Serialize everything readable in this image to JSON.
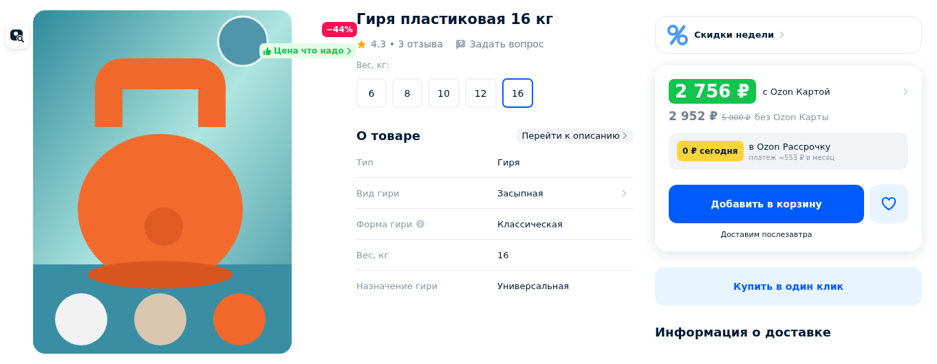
{
  "badges": {
    "discount": "−44%",
    "price_tag": "Цена что надо"
  },
  "title": "Гиря пластиковая 16 кг",
  "rating": {
    "text": "4.3 • 3 отзыва",
    "ask": "Задать вопрос"
  },
  "variants": {
    "label": "Вес, кг:",
    "options": [
      {
        "label": "6",
        "selected": false
      },
      {
        "label": "8",
        "selected": false
      },
      {
        "label": "10",
        "selected": false
      },
      {
        "label": "12",
        "selected": false
      },
      {
        "label": "16",
        "selected": true
      }
    ]
  },
  "about": {
    "title": "О товаре",
    "link": "Перейти к описанию",
    "rows": [
      {
        "name": "Тип",
        "value": "Гиря",
        "kind": "plain"
      },
      {
        "name": "Вид гири",
        "value": "Засыпная",
        "kind": "link"
      },
      {
        "name": "Форма гири",
        "value": "Классическая",
        "kind": "info"
      },
      {
        "name": "Вес, кг",
        "value": "16",
        "kind": "plain"
      },
      {
        "name": "Назначение гири",
        "value": "Универсальная",
        "kind": "plain"
      }
    ]
  },
  "promo": "Скидки недели",
  "price": {
    "card_price": "2 756 ₽",
    "card_label": "с Ozon Картой",
    "price": "2 952 ₽",
    "old_price": "5 000 ₽",
    "no_card_label": "без Ozon Карты"
  },
  "installment": {
    "badge": "0 ₽ сегодня",
    "title": "в Ozon Рассрочку",
    "note": "платеж ≈553 ₽ в месяц"
  },
  "cart_button": "Добавить в корзину",
  "delivery_note": "Доставим послезавтра",
  "one_click_button": "Купить в один клик",
  "delivery_heading": "Информация о доставке"
}
